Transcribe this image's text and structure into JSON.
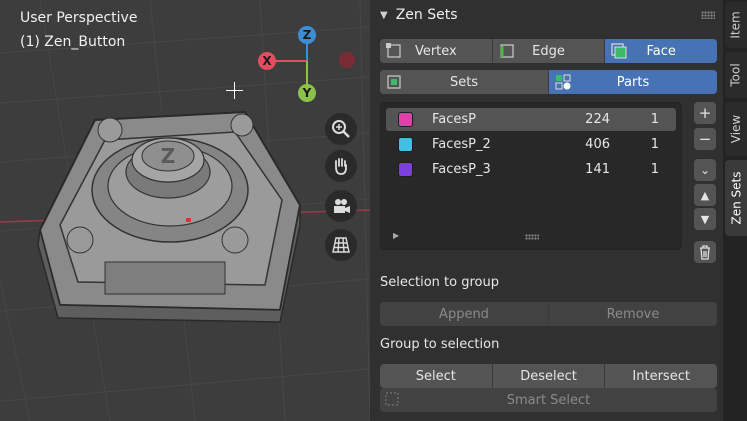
{
  "viewport": {
    "perspective": "User Perspective",
    "object": "(1) Zen_Button",
    "gizmo": {
      "x_label": "X",
      "y_label": "Y",
      "z_label": "Z",
      "x_color": "#e24d5f",
      "y_color": "#8bc34a",
      "z_color": "#3b8ed6"
    },
    "nav_icons": [
      "zoom-icon",
      "hand-pan-icon",
      "camera-icon",
      "grid-view-icon"
    ],
    "emblem_letter": "Z"
  },
  "panel": {
    "title": "Zen Sets",
    "modes": [
      {
        "label": "Vertex",
        "icon": "vertex-mode-icon",
        "active": false
      },
      {
        "label": "Edge",
        "icon": "edge-mode-icon",
        "active": false
      },
      {
        "label": "Face",
        "icon": "face-mode-icon",
        "active": true
      }
    ],
    "views": [
      {
        "label": "Sets",
        "icon": "sets-icon",
        "active": false
      },
      {
        "label": "Parts",
        "icon": "parts-icon",
        "active": true
      }
    ],
    "list": [
      {
        "color": "#e040a8",
        "name": "FacesP",
        "count": "224",
        "visible": "1",
        "selected": true
      },
      {
        "color": "#3ec1e6",
        "name": "FacesP_2",
        "count": "406",
        "visible": "1",
        "selected": false
      },
      {
        "color": "#7b3fe0",
        "name": "FacesP_3",
        "count": "141",
        "visible": "1",
        "selected": false
      }
    ],
    "side_buttons": [
      "+",
      "−",
      "⌄",
      "▲",
      "▼"
    ],
    "selection_to_group": {
      "label": "Selection to group",
      "append": "Append",
      "remove": "Remove"
    },
    "group_to_selection": {
      "label": "Group to selection",
      "select": "Select",
      "deselect": "Deselect",
      "intersect": "Intersect",
      "smart_select": "Smart Select"
    }
  },
  "tabs": [
    "Item",
    "Tool",
    "View",
    "Zen Sets"
  ],
  "active_tab": "Zen Sets",
  "accent": "#4772b3"
}
